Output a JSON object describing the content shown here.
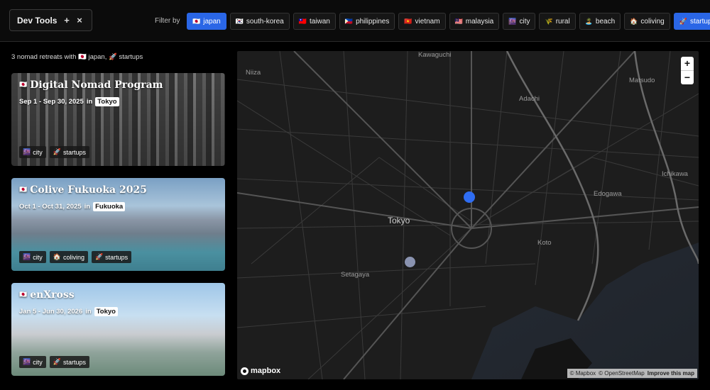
{
  "devtools": {
    "title": "Dev Tools",
    "add_symbol": "+",
    "close_symbol": "×"
  },
  "filter": {
    "label": "Filter by",
    "chips": [
      {
        "emoji": "🇯🇵",
        "label": "japan",
        "active": true
      },
      {
        "emoji": "🇰🇷",
        "label": "south-korea",
        "active": false
      },
      {
        "emoji": "🇹🇼",
        "label": "taiwan",
        "active": false
      },
      {
        "emoji": "🇵🇭",
        "label": "philippines",
        "active": false
      },
      {
        "emoji": "🇻🇳",
        "label": "vietnam",
        "active": false
      },
      {
        "emoji": "🇲🇾",
        "label": "malaysia",
        "active": false
      },
      {
        "emoji": "🌆",
        "label": "city",
        "active": false
      },
      {
        "emoji": "🌾",
        "label": "rural",
        "active": false
      },
      {
        "emoji": "🏝️",
        "label": "beach",
        "active": false
      },
      {
        "emoji": "🏠",
        "label": "coliving",
        "active": false
      },
      {
        "emoji": "🚀",
        "label": "startups",
        "active": true
      }
    ],
    "active_color": "#2a66e6"
  },
  "results": {
    "text": "3 nomad retreats with 🇯🇵 japan, 🚀 startups"
  },
  "retreats": [
    {
      "flag": "🇯🇵",
      "name": "Digital Nomad Program",
      "dates": "Sep 1 - Sep 30, 2025",
      "in_word": "in",
      "location": "Tokyo",
      "tags": [
        {
          "emoji": "🌆",
          "label": "city"
        },
        {
          "emoji": "🚀",
          "label": "startups"
        }
      ]
    },
    {
      "flag": "🇯🇵",
      "name": "Colive Fukuoka 2025",
      "dates": "Oct 1 - Oct 31, 2025",
      "in_word": "in",
      "location": "Fukuoka",
      "tags": [
        {
          "emoji": "🌆",
          "label": "city"
        },
        {
          "emoji": "🏠",
          "label": "coliving"
        },
        {
          "emoji": "🚀",
          "label": "startups"
        }
      ]
    },
    {
      "flag": "🇯🇵",
      "name": "enXross",
      "dates": "Jan 5 - Jun 30, 2026",
      "in_word": "in",
      "location": "Tokyo",
      "tags": [
        {
          "emoji": "🌆",
          "label": "city"
        },
        {
          "emoji": "🚀",
          "label": "startups"
        }
      ]
    }
  ],
  "map": {
    "labels": {
      "kawaguchi": "Kawaguchi",
      "niiza": "Niiza",
      "matsudo": "Matsudo",
      "adachi": "Adachi",
      "ichikawa": "Ichikawa",
      "edogawa": "Edogawa",
      "tokyo": "Tokyo",
      "koto": "Koto",
      "setagaya": "Setagaya"
    },
    "zoom_in": "+",
    "zoom_out": "−",
    "logo": "mapbox",
    "attribution": {
      "mapbox": "© Mapbox",
      "osm": "© OpenStreetMap",
      "improve": "Improve this map"
    },
    "marker_colors": {
      "selected": "#2f6df2",
      "default": "#8a93b0"
    }
  }
}
